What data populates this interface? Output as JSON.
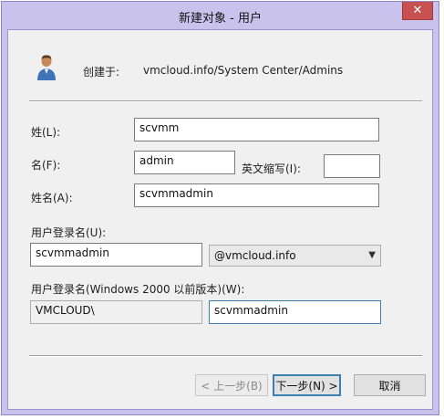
{
  "window": {
    "title": "新建对象 - 用户",
    "close_glyph": "✕"
  },
  "header": {
    "created_in_label": "创建于:",
    "created_in_path": "vmcloud.info/System Center/Admins",
    "icon": "user-icon"
  },
  "form": {
    "last_name_label": "姓(L):",
    "last_name_value": "scvmm",
    "first_name_label": "名(F):",
    "first_name_value": "admin",
    "initials_label": "英文缩写(I):",
    "initials_value": "",
    "full_name_label": "姓名(A):",
    "full_name_value": "scvmmadmin",
    "logon_name_label": "用户登录名(U):",
    "logon_name_value": "scvmmadmin",
    "upn_suffix_value": "@vmcloud.info",
    "pre2000_label": "用户登录名(Windows 2000 以前版本)(W):",
    "pre2000_domain_value": "VMCLOUD\\",
    "pre2000_name_value": "scvmmadmin"
  },
  "buttons": {
    "back_label": "< 上一步(B)",
    "next_label": "下一步(N) >",
    "cancel_label": "取消"
  },
  "colors": {
    "titlebar": "#c9c2ec",
    "close": "#c75050",
    "dialog_bg": "#f0f0f0",
    "focus": "#3c7fb1"
  }
}
